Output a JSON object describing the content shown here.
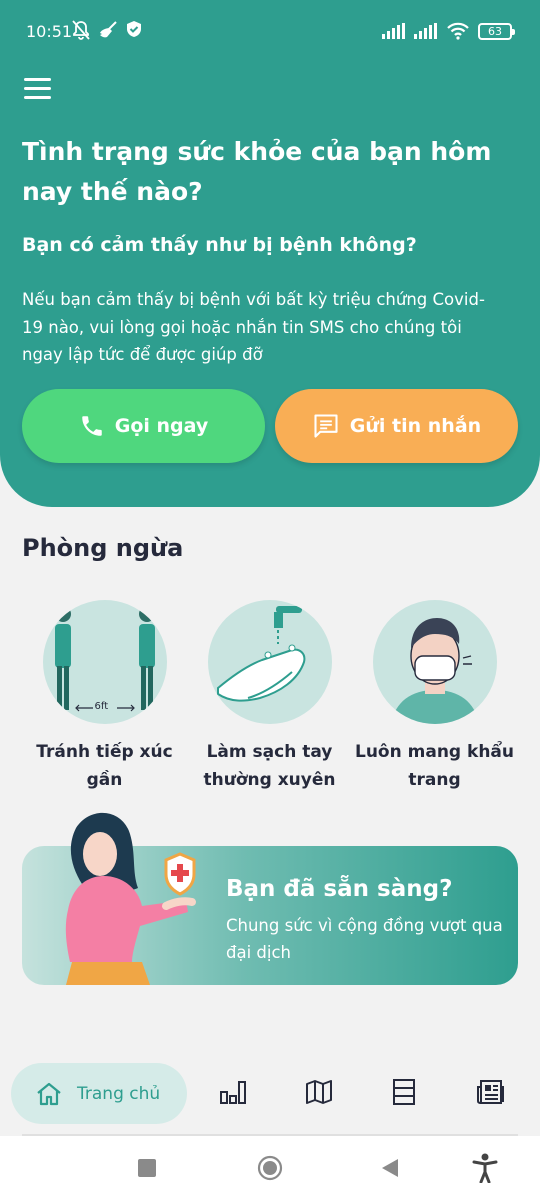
{
  "status_bar": {
    "time": "10:51",
    "battery": "63",
    "icons": [
      "bell-off-icon",
      "broom-icon",
      "shield-check-icon",
      "signal-icon",
      "signal-icon",
      "wifi-icon",
      "battery-icon"
    ]
  },
  "header": {
    "menu_icon": "hamburger-menu-icon",
    "title": "Tình trạng sức khỏe của bạn hôm nay thế nào?",
    "subtitle": "Bạn có cảm thấy như bị bệnh không?",
    "description": "Nếu bạn cảm thấy bị bệnh với bất kỳ triệu chứng Covid-19 nào, vui lòng gọi hoặc nhắn tin SMS cho chúng tôi ngay lập tức để được giúp đỡ",
    "call_button": "Gọi ngay",
    "sms_button": "Gửi tin nhắn"
  },
  "prevention": {
    "title": "Phòng ngừa",
    "distance_label": "6ft",
    "items": [
      {
        "label": "Tránh tiếp xúc gần",
        "icon": "social-distance-illustration"
      },
      {
        "label": "Làm sạch tay thường xuyên",
        "icon": "hand-washing-illustration"
      },
      {
        "label": "Luôn mang khẩu trang",
        "icon": "face-mask-illustration"
      }
    ]
  },
  "banner": {
    "title": "Bạn đã sẵn sàng?",
    "description": "Chung sức vì cộng đồng vượt qua đại dịch"
  },
  "bottom_nav": {
    "home_label": "Trang chủ",
    "items": [
      "home-icon",
      "chart-icon",
      "map-icon",
      "list-icon",
      "news-icon"
    ]
  },
  "colors": {
    "primary": "#2e9e8f",
    "call": "#4fd77e",
    "sms": "#f9ae55",
    "text": "#262a3c",
    "background": "#f2f2f2"
  }
}
